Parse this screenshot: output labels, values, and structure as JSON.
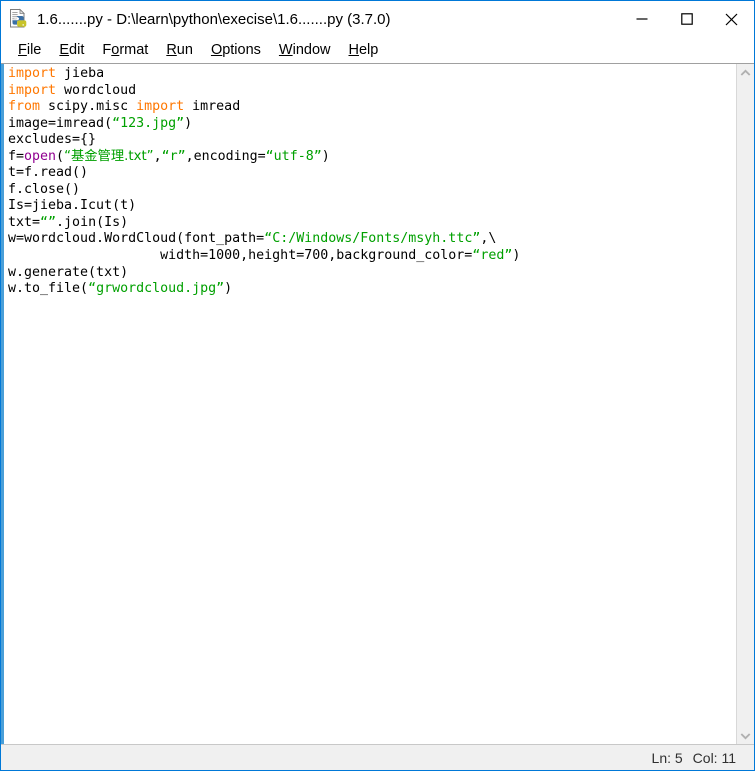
{
  "window": {
    "title": "1.6.......py - D:\\learn\\python\\execise\\1.6.......py (3.7.0)",
    "app_icon": "idle-python-file-icon",
    "accent_color": "#0078d7",
    "controls": {
      "minimize": "minimize-icon",
      "maximize": "maximize-icon",
      "close": "close-icon"
    }
  },
  "menubar": {
    "items": [
      {
        "label": "File",
        "pre": "",
        "accel": "F",
        "post": "ile"
      },
      {
        "label": "Edit",
        "pre": "",
        "accel": "E",
        "post": "dit"
      },
      {
        "label": "Format",
        "pre": "F",
        "accel": "o",
        "post": "rmat"
      },
      {
        "label": "Run",
        "pre": "",
        "accel": "R",
        "post": "un"
      },
      {
        "label": "Options",
        "pre": "",
        "accel": "O",
        "post": "ptions"
      },
      {
        "label": "Window",
        "pre": "",
        "accel": "W",
        "post": "indow"
      },
      {
        "label": "Help",
        "pre": "",
        "accel": "H",
        "post": "elp"
      }
    ]
  },
  "editor": {
    "language": "python",
    "syntax_colors": {
      "keyword": "#ff7700",
      "string": "#00a000",
      "builtin": "#900090",
      "definition": "#0000ff",
      "comment": "#dd0000",
      "text": "#000000"
    },
    "lines": [
      [
        {
          "t": "import",
          "c": "kw"
        },
        {
          "t": " jieba",
          "c": ""
        }
      ],
      [
        {
          "t": "import",
          "c": "kw"
        },
        {
          "t": " wordcloud",
          "c": ""
        }
      ],
      [
        {
          "t": "from",
          "c": "kw"
        },
        {
          "t": " scipy.misc ",
          "c": ""
        },
        {
          "t": "import",
          "c": "kw"
        },
        {
          "t": " imread",
          "c": ""
        }
      ],
      [
        {
          "t": "image=imread(",
          "c": ""
        },
        {
          "t": "“123.jpg”",
          "c": "str"
        },
        {
          "t": ")",
          "c": ""
        }
      ],
      [
        {
          "t": "excludes={}",
          "c": ""
        }
      ],
      [
        {
          "t": "f=",
          "c": ""
        },
        {
          "t": "open",
          "c": "bi"
        },
        {
          "t": "(",
          "c": ""
        },
        {
          "t": "“基金管理.txt”",
          "c": "str"
        },
        {
          "t": ",",
          "c": ""
        },
        {
          "t": "“r”",
          "c": "str"
        },
        {
          "t": ",encoding=",
          "c": ""
        },
        {
          "t": "“utf-8”",
          "c": "str"
        },
        {
          "t": ")",
          "c": ""
        }
      ],
      [
        {
          "t": "t=f.read()",
          "c": ""
        }
      ],
      [
        {
          "t": "f.close()",
          "c": ""
        }
      ],
      [
        {
          "t": "Is=jieba.Icut(t)",
          "c": ""
        }
      ],
      [
        {
          "t": "txt=",
          "c": ""
        },
        {
          "t": "“”",
          "c": "str"
        },
        {
          "t": ".join(Is)",
          "c": ""
        }
      ],
      [
        {
          "t": "w=wordcloud.WordCloud(font_path=",
          "c": ""
        },
        {
          "t": "“C:/Windows/Fonts/msyh.ttc”",
          "c": "str"
        },
        {
          "t": ",\\",
          "c": ""
        }
      ],
      [
        {
          "t": "                   width=1000,height=700,background_color=",
          "c": ""
        },
        {
          "t": "“red”",
          "c": "str"
        },
        {
          "t": ")",
          "c": ""
        }
      ],
      [
        {
          "t": "w.generate(txt)",
          "c": ""
        }
      ],
      [
        {
          "t": "w.to_file(",
          "c": ""
        },
        {
          "t": "“grwordcloud.jpg”",
          "c": "str"
        },
        {
          "t": ")",
          "c": ""
        }
      ]
    ]
  },
  "scrollbar": {
    "up_arrow": "chevron-up-icon",
    "down_arrow": "chevron-down-icon"
  },
  "statusbar": {
    "line_label": "Ln: 5",
    "col_label": "Col: 11"
  }
}
